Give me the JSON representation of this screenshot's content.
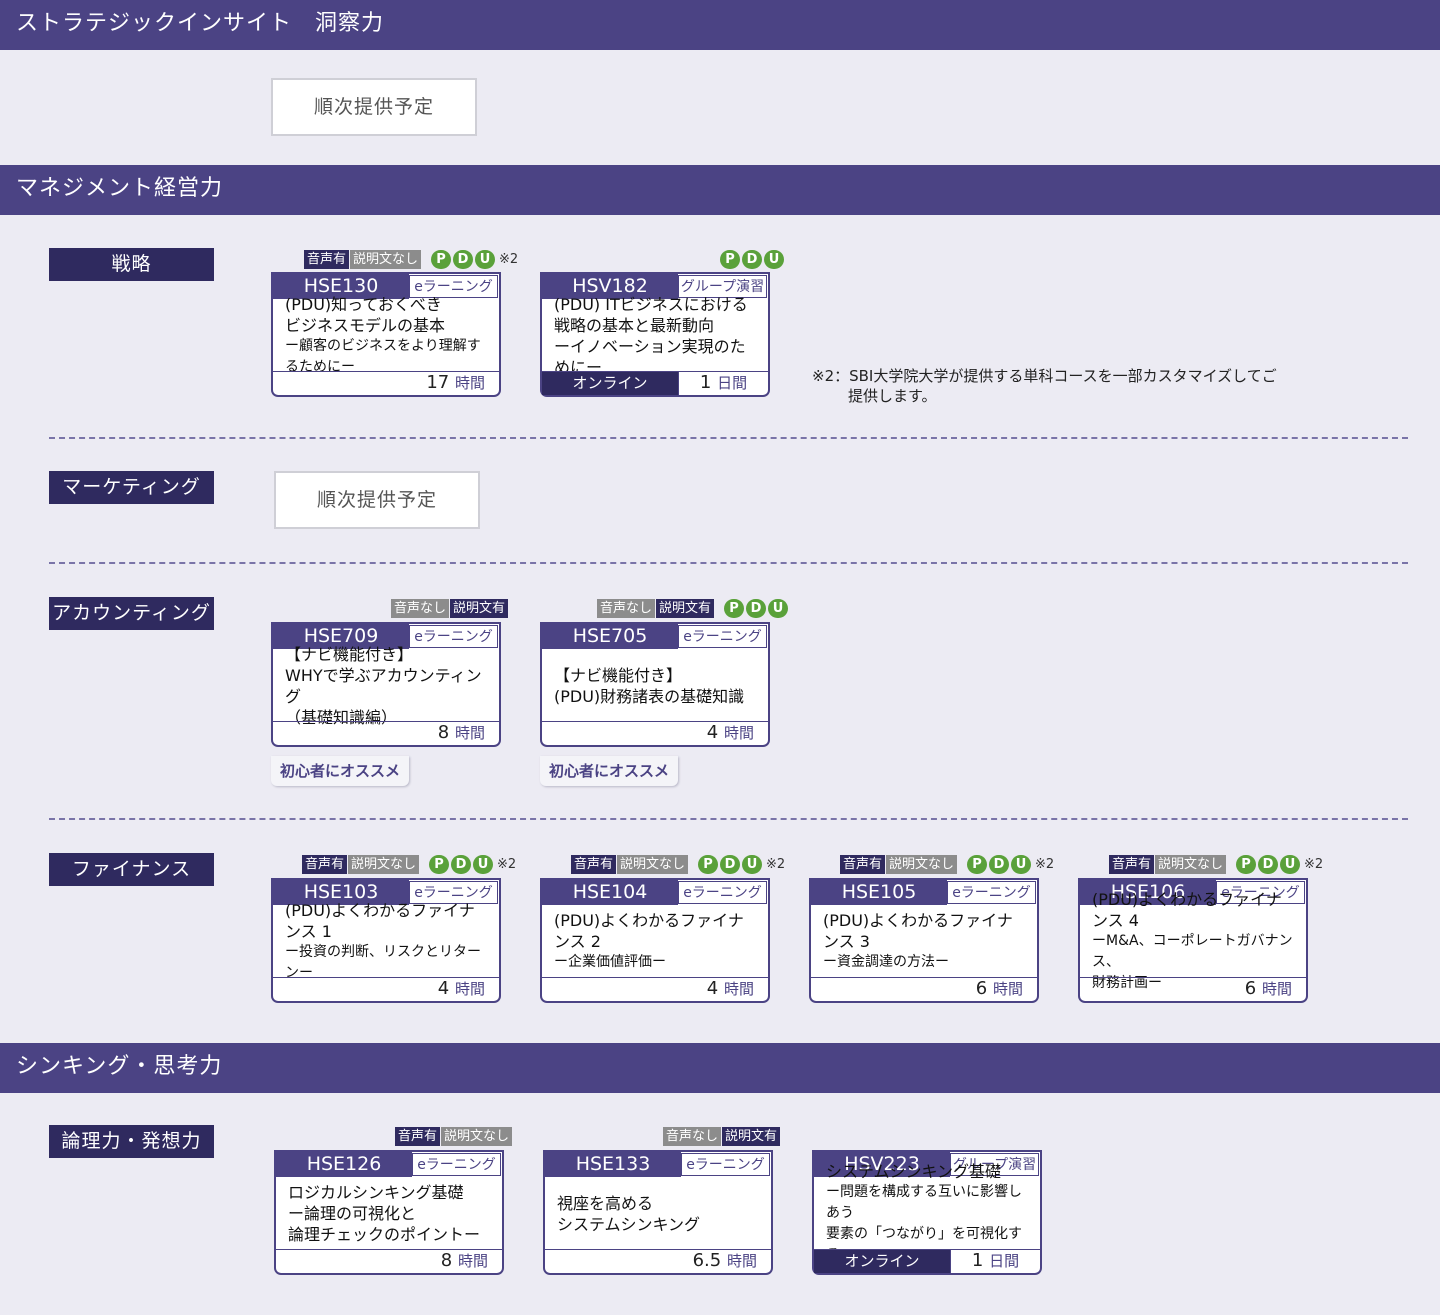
{
  "sections": {
    "insight": {
      "title": "ストラテジックインサイト　洞察力",
      "pending": "順次提供予定"
    },
    "management": {
      "title": "マネジメント経営力",
      "strategy": {
        "label": "戦略",
        "cards": [
          {
            "tags": [
              "音声有",
              "説明文なし"
            ],
            "pdu": [
              "P",
              "D",
              "U"
            ],
            "note": "※2",
            "code": "HSE130",
            "type": "eラーニング",
            "title": [
              "(PDU)知っておくべき",
              "ビジネスモデルの基本",
              "ー顧客のビジネスをより理解するためにー"
            ],
            "duration": "17",
            "unit": "時間"
          },
          {
            "pdu": [
              "P",
              "D",
              "U"
            ],
            "code": "HSV182",
            "type": "グループ演習",
            "title": [
              "(PDU) ITビジネスにおける",
              "戦略の基本と最新動向",
              "ーイノベーション実現のためにー"
            ],
            "mode": "オンライン",
            "duration": "1",
            "unit": "日間"
          }
        ],
        "footnote": [
          "※2：SBI大学院大学が提供する単科コースを一部カスタマイズしてご",
          "提供します。"
        ]
      },
      "marketing": {
        "label": "マーケティング",
        "pending": "順次提供予定"
      },
      "accounting": {
        "label": "アカウンティング",
        "cards": [
          {
            "tags": [
              "音声なし",
              "説明文有"
            ],
            "code": "HSE709",
            "type": "eラーニング",
            "title": [
              "【ナビ機能付き】",
              "WHYで学ぶアカウンティング",
              "（基礎知識編）"
            ],
            "duration": "8",
            "unit": "時間",
            "recommend": "初心者にオススメ"
          },
          {
            "tags": [
              "音声なし",
              "説明文有"
            ],
            "pdu": [
              "P",
              "D",
              "U"
            ],
            "code": "HSE705",
            "type": "eラーニング",
            "title": [
              "【ナビ機能付き】",
              "(PDU)財務諸表の基礎知識"
            ],
            "duration": "4",
            "unit": "時間",
            "recommend": "初心者にオススメ"
          }
        ]
      },
      "finance": {
        "label": "ファイナンス",
        "cards": [
          {
            "tags": [
              "音声有",
              "説明文なし"
            ],
            "pdu": [
              "P",
              "D",
              "U"
            ],
            "note": "※2",
            "code": "HSE103",
            "type": "eラーニング",
            "title": [
              "(PDU)よくわかるファイナンス 1",
              "ー投資の判断、リスクとリターンー"
            ],
            "duration": "4",
            "unit": "時間"
          },
          {
            "tags": [
              "音声有",
              "説明文なし"
            ],
            "pdu": [
              "P",
              "D",
              "U"
            ],
            "note": "※2",
            "code": "HSE104",
            "type": "eラーニング",
            "title": [
              "(PDU)よくわかるファイナンス 2",
              "ー企業価値評価ー"
            ],
            "duration": "4",
            "unit": "時間"
          },
          {
            "tags": [
              "音声有",
              "説明文なし"
            ],
            "pdu": [
              "P",
              "D",
              "U"
            ],
            "note": "※2",
            "code": "HSE105",
            "type": "eラーニング",
            "title": [
              "(PDU)よくわかるファイナンス 3",
              "ー資金調達の方法ー"
            ],
            "duration": "6",
            "unit": "時間"
          },
          {
            "tags": [
              "音声有",
              "説明文なし"
            ],
            "pdu": [
              "P",
              "D",
              "U"
            ],
            "note": "※2",
            "code": "HSE106",
            "type": "eラーニング",
            "title": [
              "(PDU)よくわかるファイナンス 4",
              "ーM&A、コーポレートガバナンス、",
              "財務計画ー"
            ],
            "duration": "6",
            "unit": "時間"
          }
        ]
      }
    },
    "thinking": {
      "title": "シンキング・思考力",
      "logic": {
        "label": "論理力・発想力",
        "cards": [
          {
            "tags": [
              "音声有",
              "説明文なし"
            ],
            "code": "HSE126",
            "type": "eラーニング",
            "title": [
              "ロジカルシンキング基礎",
              "ー論理の可視化と",
              "論理チェックのポイントー"
            ],
            "duration": "8",
            "unit": "時間"
          },
          {
            "tags": [
              "音声なし",
              "説明文有"
            ],
            "code": "HSE133",
            "type": "eラーニング",
            "title": [
              "視座を高める",
              "システムシンキング"
            ],
            "duration": "6.5",
            "unit": "時間"
          },
          {
            "code": "HSV223",
            "type": "グループ演習",
            "title": [
              "システムシンキング基礎",
              "ー問題を構成する互いに影響しあう",
              "要素の「つながり」を可視化するー"
            ],
            "mode": "オンライン",
            "duration": "1",
            "unit": "日間"
          }
        ]
      }
    }
  }
}
